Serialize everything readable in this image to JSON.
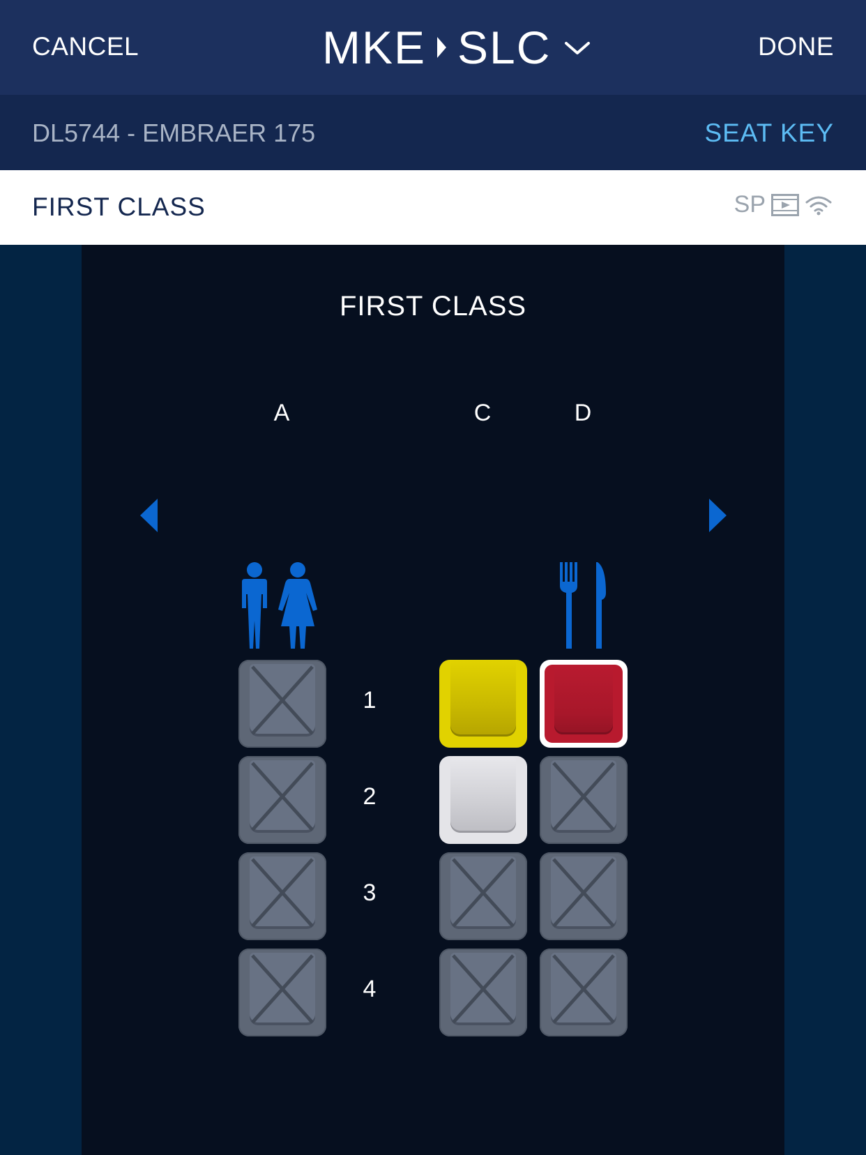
{
  "header": {
    "cancel_label": "CANCEL",
    "origin": "MKE",
    "destination": "SLC",
    "done_label": "DONE"
  },
  "flight_bar": {
    "flight_info": "DL5744 - EMBRAER 175",
    "seat_key_label": "SEAT KEY"
  },
  "cabin_bar": {
    "label": "FIRST CLASS",
    "amenity_sp": "SP",
    "amenity_icons": [
      "video-icon",
      "wifi-icon"
    ]
  },
  "seat_map": {
    "cabin_title": "FIRST CLASS",
    "columns": [
      "A",
      "C",
      "D"
    ],
    "rows": [
      "1",
      "2",
      "3",
      "4"
    ],
    "colors": {
      "available_preferred": "#e1d200",
      "available": "#e4e4e8",
      "selected": "#b81a2e",
      "unavailable": "#5e6776",
      "accent": "#0b67d1"
    },
    "seats": {
      "1A": "unavailable",
      "1C": "available-preferred",
      "1D": "selected",
      "2A": "unavailable",
      "2C": "available",
      "2D": "unavailable",
      "3A": "unavailable",
      "3C": "unavailable",
      "3D": "unavailable",
      "4A": "unavailable",
      "4C": "unavailable",
      "4D": "unavailable"
    }
  }
}
